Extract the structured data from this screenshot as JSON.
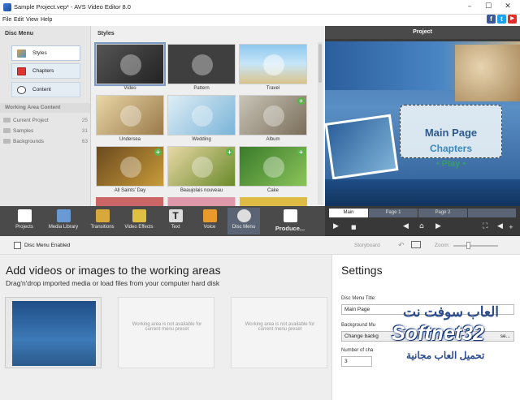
{
  "window": {
    "title": "Sample Project.vep* - AVS Video Editor 8.0",
    "minimize": "–",
    "maximize": "☐",
    "close": "✕"
  },
  "menu": [
    "File",
    "Edit",
    "View",
    "Help"
  ],
  "social": [
    "f",
    "t",
    "▶"
  ],
  "left": {
    "header": "Disc Menu",
    "buttons": [
      "Styles",
      "Chapters",
      "Content"
    ],
    "working_header": "Working Area Content",
    "working_items": [
      {
        "label": "Current Project",
        "count": "25"
      },
      {
        "label": "Samples",
        "count": "31"
      },
      {
        "label": "Backgrounds",
        "count": "63"
      }
    ]
  },
  "styles": {
    "header": "Styles",
    "items": [
      "Video",
      "Pattern",
      "Travel",
      "Undersea",
      "Wedding",
      "Album",
      "All Saints' Day",
      "Beaujolais nouveau",
      "Cake"
    ]
  },
  "project": {
    "header": "Project",
    "menu_title": "Main Page",
    "menu_chapters": "Chapters",
    "menu_play": "• Play •"
  },
  "toolbar": [
    "Projects",
    "Media Library",
    "Transitions",
    "Video Effects",
    "Text",
    "Voice",
    "Disc Menu",
    "Produce..."
  ],
  "pages": [
    "Main",
    "Page 1",
    "Page 2"
  ],
  "subbar": {
    "enabled_label": "Disc Menu Enabled",
    "storyboard": "Storyboard",
    "zoom": "Zoom:"
  },
  "work": {
    "title": "Add videos or images to the working areas",
    "subtitle": "Drag'n'drop imported media or load files from your computer hard disk",
    "na_text": "Working area is not available for current menu preset"
  },
  "settings": {
    "title": "Settings",
    "menu_title_label": "Disc Menu Title:",
    "menu_title_value": "Main Page",
    "bg_music_label": "Background Mu",
    "bg_music_button": "Change backg",
    "browse": "se...",
    "chapters_label": "Number of cha",
    "chapters_value": "3"
  },
  "watermark": {
    "line1": "العاب سوفت نت",
    "line2": "Softnet32",
    "line3": "تحميل العاب مجانية"
  },
  "colors": {
    "accent": "#5a6474",
    "toolbar_bg": "#4a4a4a",
    "plus": "#57b846"
  }
}
